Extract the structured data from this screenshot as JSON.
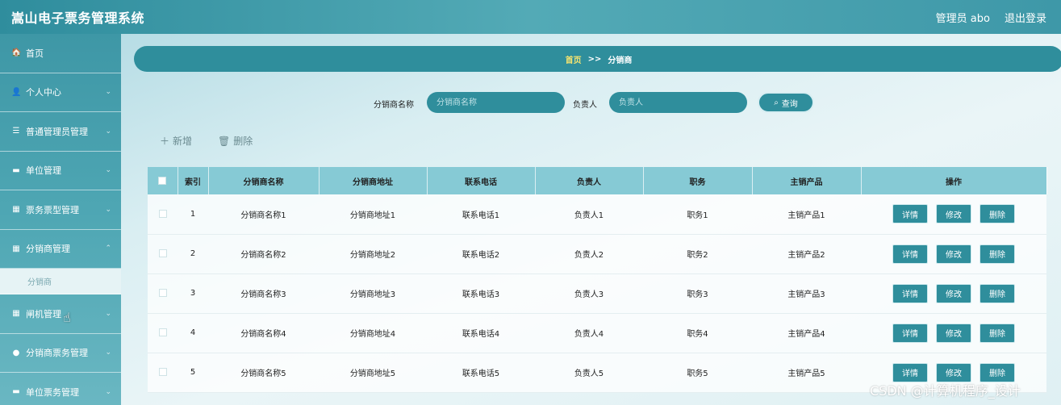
{
  "header": {
    "title": "嵩山电子票务管理系统",
    "user_label": "管理员 abo",
    "logout": "退出登录"
  },
  "sidebar": {
    "items": [
      {
        "label": "首页",
        "icon": "home-icon",
        "glyph": "🏠"
      },
      {
        "label": "个人中心",
        "icon": "user-icon",
        "glyph": "👤"
      },
      {
        "label": "普通管理员管理",
        "icon": "list-icon",
        "glyph": "☰"
      },
      {
        "label": "单位管理",
        "icon": "monitor-icon",
        "glyph": "▬"
      },
      {
        "label": "票务票型管理",
        "icon": "grid-icon",
        "glyph": "▦"
      },
      {
        "label": "分销商管理",
        "icon": "grid-icon",
        "glyph": "▦"
      },
      {
        "label": "闸机管理",
        "icon": "grid-icon",
        "glyph": "▦"
      },
      {
        "label": "分销商票务管理",
        "icon": "location-icon",
        "glyph": "●"
      },
      {
        "label": "单位票务管理",
        "icon": "monitor-icon",
        "glyph": "▬"
      }
    ],
    "submenu": "分销商"
  },
  "breadcrumb": {
    "home": "首页",
    "sep": ">>",
    "current": "分销商"
  },
  "search": {
    "name_label": "分销商名称",
    "name_placeholder": "分销商名称",
    "owner_label": "负责人",
    "owner_placeholder": "负责人",
    "query": "查询"
  },
  "actions": {
    "add": "新增",
    "delete": "删除"
  },
  "table": {
    "headers": [
      "索引",
      "分销商名称",
      "分销商地址",
      "联系电话",
      "负责人",
      "职务",
      "主销产品",
      "操作"
    ],
    "rows": [
      [
        "1",
        "分销商名称1",
        "分销商地址1",
        "联系电话1",
        "负责人1",
        "职务1",
        "主销产品1"
      ],
      [
        "2",
        "分销商名称2",
        "分销商地址2",
        "联系电话2",
        "负责人2",
        "职务2",
        "主销产品2"
      ],
      [
        "3",
        "分销商名称3",
        "分销商地址3",
        "联系电话3",
        "负责人3",
        "职务3",
        "主销产品3"
      ],
      [
        "4",
        "分销商名称4",
        "分销商地址4",
        "联系电话4",
        "负责人4",
        "职务4",
        "主销产品4"
      ],
      [
        "5",
        "分销商名称5",
        "分销商地址5",
        "联系电话5",
        "负责人5",
        "职务5",
        "主销产品5"
      ]
    ],
    "ops": {
      "detail": "详情",
      "edit": "修改",
      "delete": "删除"
    }
  },
  "watermark": "CSDN @计算机程序_设计",
  "colors": {
    "primary": "#2f8e9c",
    "header_bg": "#86cad5",
    "breadcrumb_home": "#f6e46f"
  }
}
